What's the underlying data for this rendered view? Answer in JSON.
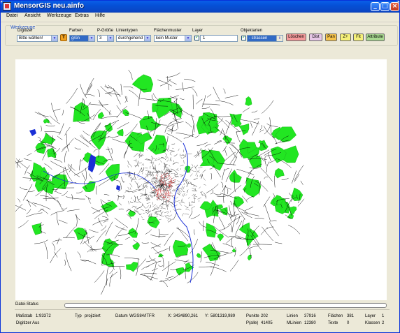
{
  "window": {
    "title": "MensorGIS neu.ainfo"
  },
  "title_buttons": {
    "minimize": "_",
    "maximize": "□",
    "close": "×"
  },
  "menu": [
    "Datei",
    "Ansicht",
    "Werkzeuge",
    "Extras",
    "Hilfe"
  ],
  "toolbar": {
    "group_label": "Werkzeuge",
    "digitizer": {
      "label": "Digitizer",
      "value": "Bitte wählen!"
    },
    "color_swatch_text": "T",
    "farben": {
      "label": "Farben",
      "value": "grün"
    },
    "pgroesse": {
      "label": "P-Größe",
      "value": "3"
    },
    "linientypen": {
      "label": "Linientypen",
      "value": "durchgehend"
    },
    "flaechenmuster": {
      "label": "Flächenmuster",
      "value": "kein Muster"
    },
    "layer": {
      "label": "Layer",
      "value": "1"
    },
    "objektarten": {
      "label": "Objektarten",
      "value": "- strassen"
    },
    "buttons": {
      "loeschen": "Löschen",
      "dist": "Dist",
      "pan": "Pan",
      "zplus": "Z+",
      "fit": "Fit",
      "attribute": "Attribute"
    }
  },
  "status": {
    "datei_status": "Datei-Status",
    "massstab_label": "Maßstab",
    "massstab_value": "1:93372",
    "typ_label": "Typ",
    "typ_value": "projiziert",
    "datum_label": "Datum",
    "datum_value": "WGS84/ITFR",
    "x_label": "X:",
    "x_value": "3434890,261",
    "y_label": "Y:",
    "y_value": "5801319,989",
    "punkte_label": "Punkte",
    "punkte_value": "202",
    "palle_label": "P(alle)",
    "palle_value": "41405",
    "linien_label": "Linien",
    "linien_value": "37916",
    "mlinien_label": "MLinien",
    "mlinien_value": "12380",
    "flaechen_label": "Flächen",
    "flaechen_value": "381",
    "texte_label": "Texte",
    "texte_value": "0",
    "layer_label": "Layer",
    "layer_value": "1",
    "klassen_label": "Klassen",
    "klassen_value": "2",
    "digitizer_status": "Digitizer Aus"
  },
  "colors": {
    "forest": "#22e622",
    "roads": "#000000",
    "water": "#1a2fd6",
    "center": "#cc2222"
  }
}
